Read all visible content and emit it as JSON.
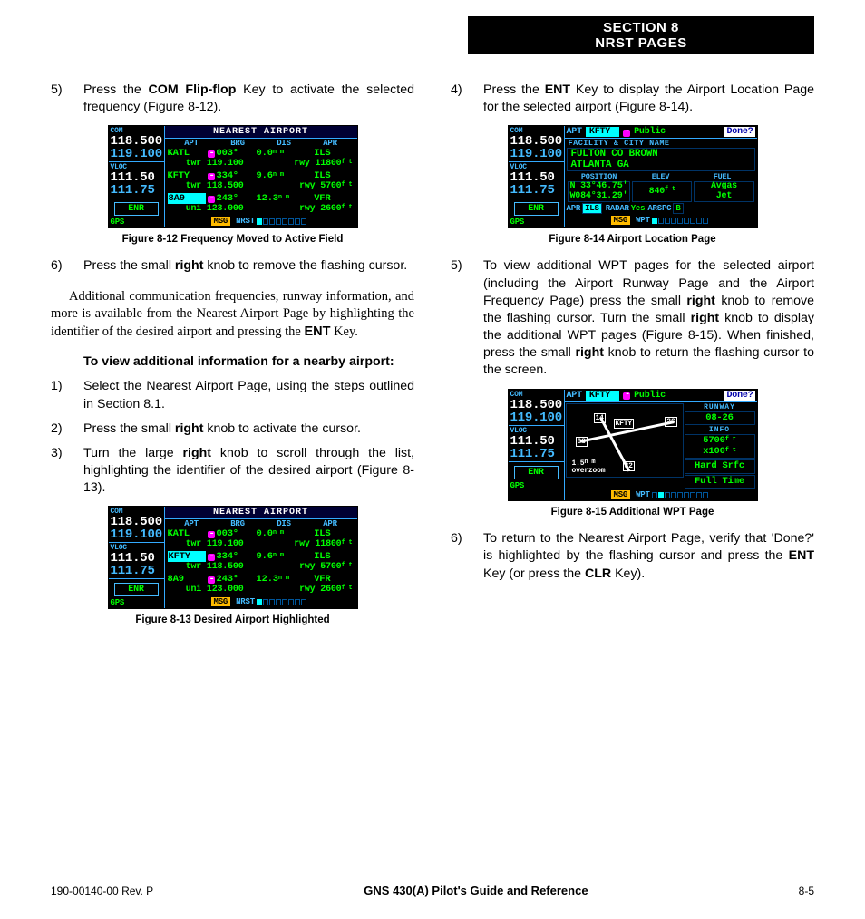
{
  "header": {
    "line1": "SECTION 8",
    "line2": "NRST PAGES"
  },
  "left": {
    "step5": {
      "num": "5)",
      "pre": "Press the ",
      "key": "COM Flip-flop",
      "post": " Key to activate the selected frequency (Figure 8-12)."
    },
    "fig12_caption": "Figure 8-12  Frequency Moved to Active Field",
    "step6": {
      "num": "6)",
      "pre": "Press the small ",
      "key": "right",
      "post": " knob to remove the flashing cursor."
    },
    "body": {
      "pre": "Additional communication frequencies, runway information, and more is available from the Nearest Airport Page by highlighting the identifier of the desired airport and pressing the ",
      "key": "ENT",
      "post": " Key."
    },
    "subhead": "To view additional information for a nearby airport:",
    "s1": {
      "num": "1)",
      "txt": "Select the Nearest Airport Page, using the steps outlined in Section 8.1."
    },
    "s2": {
      "num": "2)",
      "pre": "Press the small ",
      "key": "right",
      "post": " knob to activate the cursor."
    },
    "s3": {
      "num": "3)",
      "pre": "Turn the large ",
      "key": "right",
      "post": " knob to scroll through the list, highlighting the identifier of the desired airport (Figure 8-13)."
    },
    "fig13_caption": "Figure 8-13  Desired Airport Highlighted"
  },
  "right": {
    "step4": {
      "num": "4)",
      "pre": "Press the ",
      "key": "ENT",
      "post": " Key to display the Airport Location Page for the selected airport (Figure 8-14)."
    },
    "fig14_caption": "Figure 8-14  Airport Location Page",
    "step5": {
      "num": "5)",
      "a": "To view additional WPT pages for the selected airport (including the Airport Runway Page and the Airport Frequency Page) press the small ",
      "k1": "right",
      "b": " knob to remove the flashing cursor.  Turn the small ",
      "k2": "right",
      "c": " knob to display the additional WPT pages (Figure 8-15).  When finished, press the small ",
      "k3": "right",
      "d": " knob to return the flashing cursor to the screen."
    },
    "fig15_caption": "Figure 8-15  Additional WPT Page",
    "step6": {
      "num": "6)",
      "a": "To return to the Nearest Airport Page, verify that 'Done?' is highlighted by the flashing cursor and press the ",
      "k1": "ENT",
      "b": " Key (or press the ",
      "k2": "CLR",
      "c": " Key)."
    }
  },
  "gps_common": {
    "com": "COM",
    "vloc": "VLOC",
    "enr": "ENR",
    "gps": "GPS",
    "msg": "MSG",
    "com_act": "118.500",
    "com_sby": "119.100",
    "vloc_act": "111.50",
    "vloc_sby": "111.75",
    "title": "NEAREST AIRPORT",
    "hdr": {
      "apt": "APT",
      "brg": "BRG",
      "dis": "DIS",
      "apr": "APR"
    },
    "nm": "n m",
    "ft": "f t",
    "rows": [
      {
        "apt": "KATL",
        "brg": "003°",
        "dis": "0.0",
        "apr": "ILS",
        "twr": "twr 119.100",
        "rwy": "rwy 11800"
      },
      {
        "apt": "KFTY",
        "brg": "334°",
        "dis": "9.6",
        "apr": "ILS",
        "twr": "twr 118.500",
        "rwy": "rwy  5700"
      },
      {
        "apt": "8A9",
        "brg": "243°",
        "dis": "12.3",
        "apr": "VFR",
        "twr": "uni 123.000",
        "rwy": "rwy  2600"
      }
    ],
    "nrst": "NRST"
  },
  "fig14": {
    "apt": "APT",
    "id": "KFTY",
    "pub": "Public",
    "done": "Done?",
    "fac_hdr": "FACILITY & CITY NAME",
    "fac1": "FULTON CO BROWN",
    "fac2": "ATLANTA GA",
    "pos": "POSITION",
    "elev": "ELEV",
    "fuel": "FUEL",
    "lat": "N  33°46.75'",
    "lon": "W084°31.29'",
    "elev_v": "840",
    "fuel1": "Avgas",
    "fuel2": "Jet",
    "aprl": "APR",
    "ils": "ILS",
    "radar": "RADAR",
    "yes": "Yes",
    "arspc": "ARSPC",
    "b": "B",
    "wpt": "WPT"
  },
  "fig15": {
    "apt": "APT",
    "id": "KFTY",
    "pub": "Public",
    "done": "Done?",
    "runway_hdr": "RUNWAY",
    "rwy": "08-26",
    "info_hdr": "INFO",
    "len": "5700",
    "mul": "x100",
    "surf": "Hard Srfc",
    "time": "Full Time",
    "map_id": "KFTY",
    "r14": "14",
    "r26": "26",
    "r08": "08",
    "r32": "32",
    "zoom1": "1.5",
    "zoom2": "overzoom",
    "wpt": "WPT"
  },
  "footer": {
    "left": "190-00140-00  Rev. P",
    "mid": "GNS 430(A) Pilot's Guide and Reference",
    "right": "8-5"
  }
}
